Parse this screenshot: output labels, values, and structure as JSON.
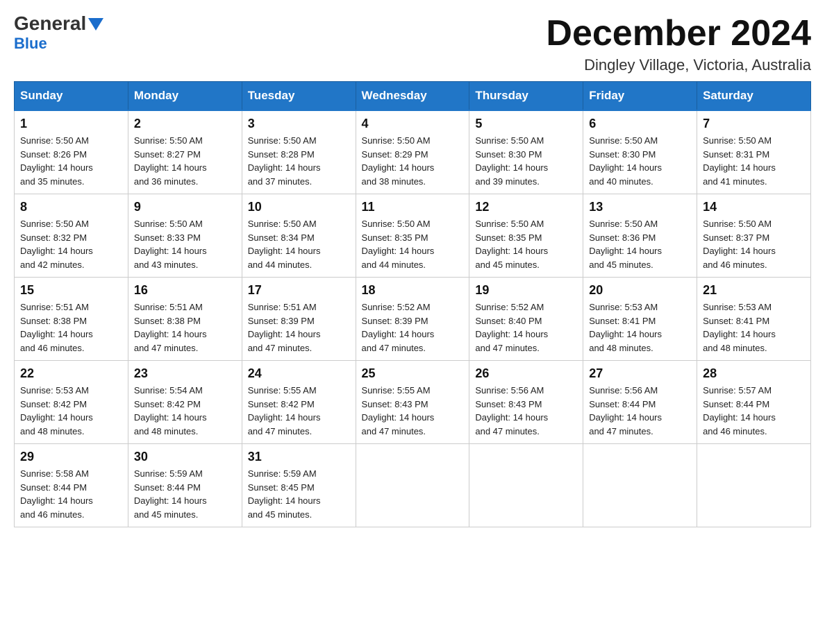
{
  "logo": {
    "name": "General",
    "name2": "Blue"
  },
  "title": "December 2024",
  "location": "Dingley Village, Victoria, Australia",
  "days_of_week": [
    "Sunday",
    "Monday",
    "Tuesday",
    "Wednesday",
    "Thursday",
    "Friday",
    "Saturday"
  ],
  "weeks": [
    [
      {
        "day": "1",
        "sunrise": "5:50 AM",
        "sunset": "8:26 PM",
        "daylight": "14 hours and 35 minutes."
      },
      {
        "day": "2",
        "sunrise": "5:50 AM",
        "sunset": "8:27 PM",
        "daylight": "14 hours and 36 minutes."
      },
      {
        "day": "3",
        "sunrise": "5:50 AM",
        "sunset": "8:28 PM",
        "daylight": "14 hours and 37 minutes."
      },
      {
        "day": "4",
        "sunrise": "5:50 AM",
        "sunset": "8:29 PM",
        "daylight": "14 hours and 38 minutes."
      },
      {
        "day": "5",
        "sunrise": "5:50 AM",
        "sunset": "8:30 PM",
        "daylight": "14 hours and 39 minutes."
      },
      {
        "day": "6",
        "sunrise": "5:50 AM",
        "sunset": "8:30 PM",
        "daylight": "14 hours and 40 minutes."
      },
      {
        "day": "7",
        "sunrise": "5:50 AM",
        "sunset": "8:31 PM",
        "daylight": "14 hours and 41 minutes."
      }
    ],
    [
      {
        "day": "8",
        "sunrise": "5:50 AM",
        "sunset": "8:32 PM",
        "daylight": "14 hours and 42 minutes."
      },
      {
        "day": "9",
        "sunrise": "5:50 AM",
        "sunset": "8:33 PM",
        "daylight": "14 hours and 43 minutes."
      },
      {
        "day": "10",
        "sunrise": "5:50 AM",
        "sunset": "8:34 PM",
        "daylight": "14 hours and 44 minutes."
      },
      {
        "day": "11",
        "sunrise": "5:50 AM",
        "sunset": "8:35 PM",
        "daylight": "14 hours and 44 minutes."
      },
      {
        "day": "12",
        "sunrise": "5:50 AM",
        "sunset": "8:35 PM",
        "daylight": "14 hours and 45 minutes."
      },
      {
        "day": "13",
        "sunrise": "5:50 AM",
        "sunset": "8:36 PM",
        "daylight": "14 hours and 45 minutes."
      },
      {
        "day": "14",
        "sunrise": "5:50 AM",
        "sunset": "8:37 PM",
        "daylight": "14 hours and 46 minutes."
      }
    ],
    [
      {
        "day": "15",
        "sunrise": "5:51 AM",
        "sunset": "8:38 PM",
        "daylight": "14 hours and 46 minutes."
      },
      {
        "day": "16",
        "sunrise": "5:51 AM",
        "sunset": "8:38 PM",
        "daylight": "14 hours and 47 minutes."
      },
      {
        "day": "17",
        "sunrise": "5:51 AM",
        "sunset": "8:39 PM",
        "daylight": "14 hours and 47 minutes."
      },
      {
        "day": "18",
        "sunrise": "5:52 AM",
        "sunset": "8:39 PM",
        "daylight": "14 hours and 47 minutes."
      },
      {
        "day": "19",
        "sunrise": "5:52 AM",
        "sunset": "8:40 PM",
        "daylight": "14 hours and 47 minutes."
      },
      {
        "day": "20",
        "sunrise": "5:53 AM",
        "sunset": "8:41 PM",
        "daylight": "14 hours and 48 minutes."
      },
      {
        "day": "21",
        "sunrise": "5:53 AM",
        "sunset": "8:41 PM",
        "daylight": "14 hours and 48 minutes."
      }
    ],
    [
      {
        "day": "22",
        "sunrise": "5:53 AM",
        "sunset": "8:42 PM",
        "daylight": "14 hours and 48 minutes."
      },
      {
        "day": "23",
        "sunrise": "5:54 AM",
        "sunset": "8:42 PM",
        "daylight": "14 hours and 48 minutes."
      },
      {
        "day": "24",
        "sunrise": "5:55 AM",
        "sunset": "8:42 PM",
        "daylight": "14 hours and 47 minutes."
      },
      {
        "day": "25",
        "sunrise": "5:55 AM",
        "sunset": "8:43 PM",
        "daylight": "14 hours and 47 minutes."
      },
      {
        "day": "26",
        "sunrise": "5:56 AM",
        "sunset": "8:43 PM",
        "daylight": "14 hours and 47 minutes."
      },
      {
        "day": "27",
        "sunrise": "5:56 AM",
        "sunset": "8:44 PM",
        "daylight": "14 hours and 47 minutes."
      },
      {
        "day": "28",
        "sunrise": "5:57 AM",
        "sunset": "8:44 PM",
        "daylight": "14 hours and 46 minutes."
      }
    ],
    [
      {
        "day": "29",
        "sunrise": "5:58 AM",
        "sunset": "8:44 PM",
        "daylight": "14 hours and 46 minutes."
      },
      {
        "day": "30",
        "sunrise": "5:59 AM",
        "sunset": "8:44 PM",
        "daylight": "14 hours and 45 minutes."
      },
      {
        "day": "31",
        "sunrise": "5:59 AM",
        "sunset": "8:45 PM",
        "daylight": "14 hours and 45 minutes."
      },
      null,
      null,
      null,
      null
    ]
  ],
  "labels": {
    "sunrise": "Sunrise:",
    "sunset": "Sunset:",
    "daylight": "Daylight:"
  }
}
